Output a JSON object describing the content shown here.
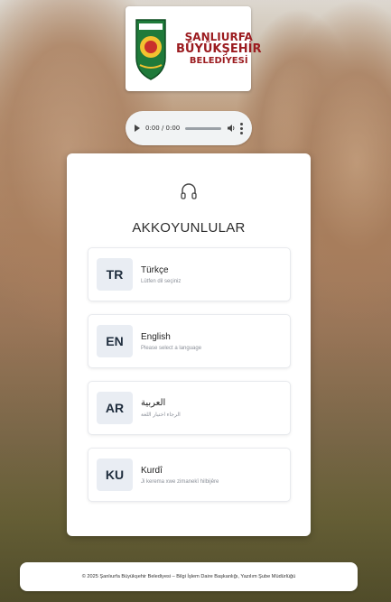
{
  "logo": {
    "line1": "ŞANLIURFA",
    "line2": "BÜYÜKŞEHİR",
    "line3": "BELEDİYESİ",
    "brand_color": "#9b1b1f"
  },
  "audio": {
    "time": "0:00 / 0:00",
    "icons": [
      "play-icon",
      "volume-icon",
      "more-options-icon"
    ]
  },
  "card": {
    "icon": "headphones-icon",
    "title": "AKKOYUNLULAR"
  },
  "languages": [
    {
      "code": "TR",
      "name": "Türkçe",
      "subtitle": "Lütfen dil seçiniz"
    },
    {
      "code": "EN",
      "name": "English",
      "subtitle": "Please select a language"
    },
    {
      "code": "AR",
      "name": "العربية",
      "subtitle": "الرجاء اختيار اللغة"
    },
    {
      "code": "KU",
      "name": "Kurdî",
      "subtitle": "Ji kerema xwe zimanekî hilbijêre"
    }
  ],
  "footer": {
    "text": "© 2025 Şanlıurfa Büyükşehir Belediyesi – Bilgi İşlem Daire Başkanlığı, Yazılım Şube Müdürlüğü"
  }
}
